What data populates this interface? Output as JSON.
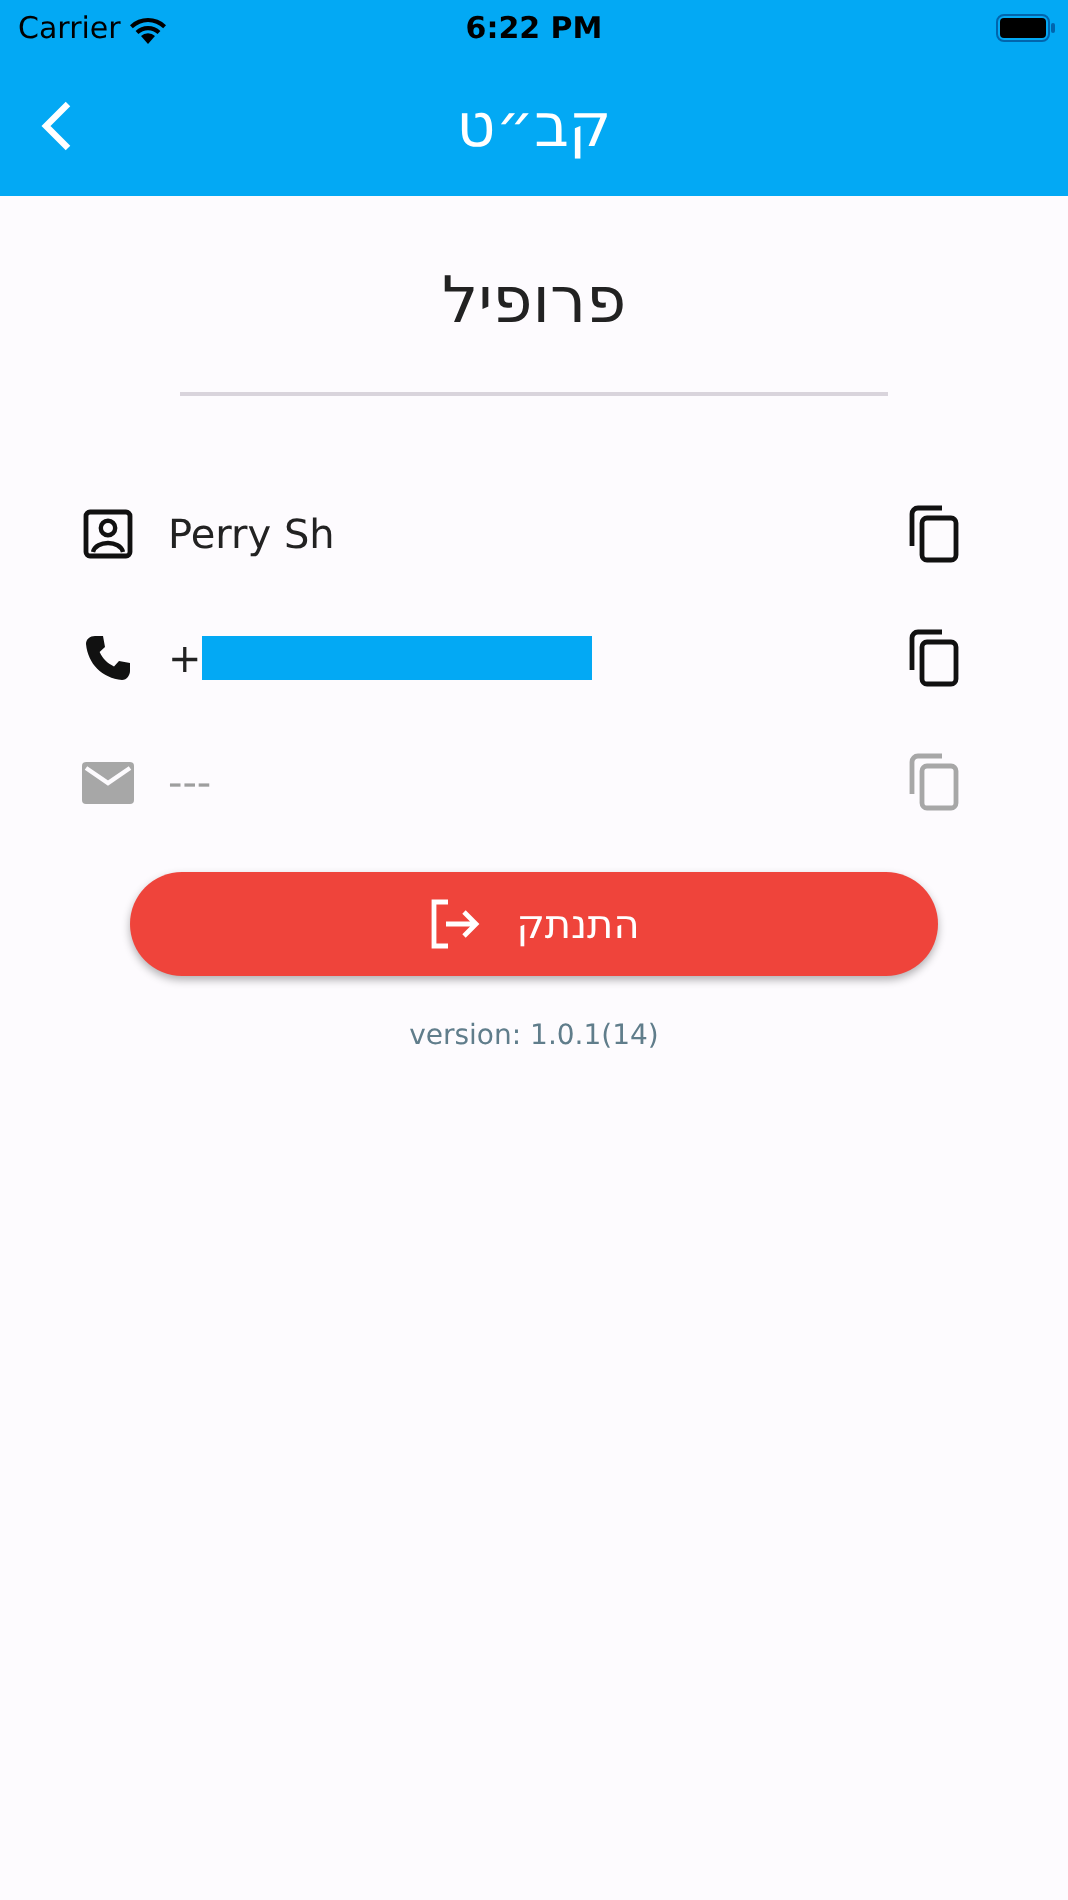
{
  "status_bar": {
    "carrier": "Carrier",
    "time": "6:22 PM"
  },
  "header": {
    "title": "קב״ט"
  },
  "page_title": "פרופיל",
  "fields": [
    {
      "kind": "person",
      "value": "Perry Sh",
      "redacted": false,
      "disabled": false
    },
    {
      "kind": "phone",
      "value": "+",
      "redacted": true,
      "disabled": false
    },
    {
      "kind": "email",
      "value": "---",
      "redacted": false,
      "disabled": true
    }
  ],
  "logout_button": {
    "label": "התנתק"
  },
  "version": "version: 1.0.1(14)"
}
